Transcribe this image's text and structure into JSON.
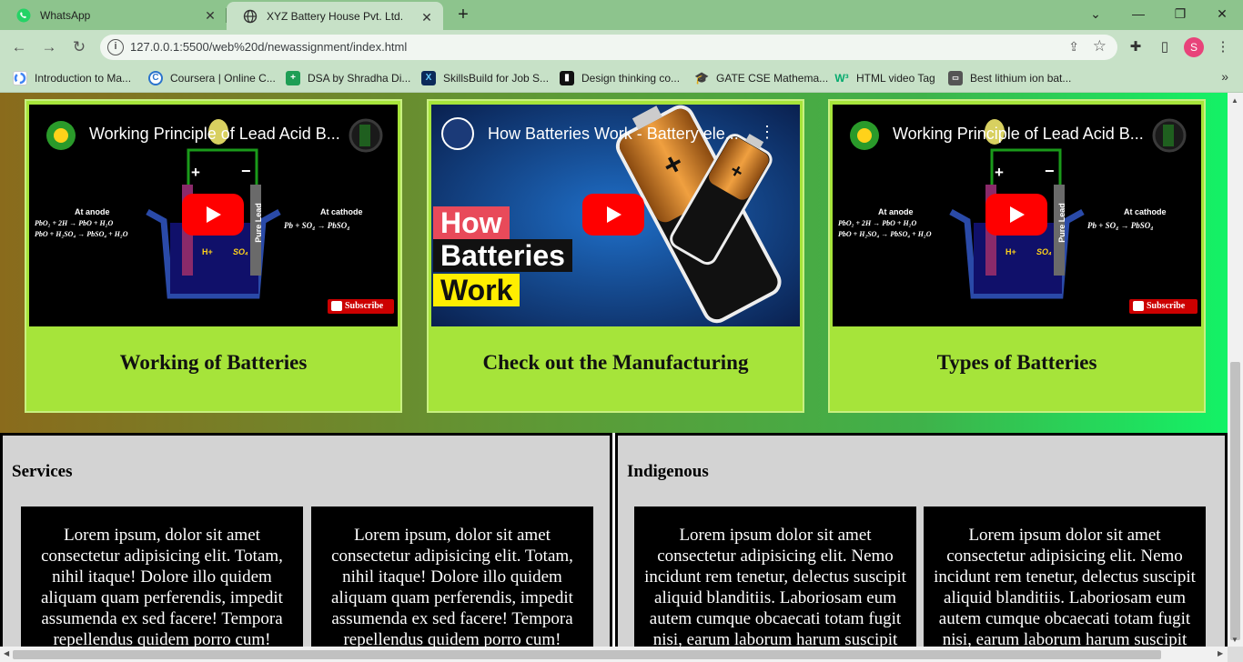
{
  "browser": {
    "tabs": [
      {
        "title": "WhatsApp",
        "icon": "whatsapp-icon"
      },
      {
        "title": "XYZ Battery House Pvt. Ltd.",
        "icon": "globe-icon"
      }
    ],
    "url": "127.0.0.1:5500/web%20d/newassignment/index.html",
    "profile_initial": "S",
    "bookmarks": [
      {
        "label": "Introduction to Ma...",
        "icon": "google-icon"
      },
      {
        "label": "Coursera | Online C...",
        "icon": "coursera-icon"
      },
      {
        "label": "DSA by Shradha Di...",
        "icon": "plus-doc-icon"
      },
      {
        "label": "SkillsBuild for Job S...",
        "icon": "skillsbuild-icon"
      },
      {
        "label": "Design thinking co...",
        "icon": "design-icon"
      },
      {
        "label": "GATE CSE Mathema...",
        "icon": "graduation-cap-icon"
      },
      {
        "label": "HTML video Tag",
        "icon": "w3-icon"
      },
      {
        "label": "Best lithium ion bat...",
        "icon": "battery-icon"
      }
    ]
  },
  "videos": [
    {
      "video_title": "Working Principle of Lead Acid B...",
      "caption": "Working of Batteries",
      "diagram": {
        "anode_heading": "At anode",
        "anode_line1": "PbO₂ + 2H → PbO + H₂O",
        "anode_line2": "PbO + H₂SO₄ → PbSO₄ + H₂O",
        "cathode_heading": "At cathode",
        "cathode_line": "Pb + SO₄ → PbSO₄",
        "plus_sign": "+",
        "minus_sign": "−",
        "right_plate": "Pure Lead",
        "ion_h": "H+",
        "ion_so4": "SO₄",
        "subscribe": "Subscribe"
      }
    },
    {
      "video_title": "How Batteries Work - Battery ele...",
      "caption": "Check out the Manufacturing",
      "overlay": {
        "line1": "How",
        "line2": "Batteries",
        "line3": "Work"
      }
    },
    {
      "video_title": "Working Principle of Lead Acid B...",
      "caption": "Types of Batteries",
      "diagram": {
        "anode_heading": "At anode",
        "anode_line1": "PbO₂ + 2H → PbO + H₂O",
        "anode_line2": "PbO + H₂SO₄ → PbSO₄ + H₂O",
        "cathode_heading": "At cathode",
        "cathode_line": "Pb + SO₄ → PbSO₄",
        "plus_sign": "+",
        "minus_sign": "−",
        "right_plate": "Pure Lead",
        "ion_h": "H+",
        "ion_so4": "SO₄",
        "subscribe": "Subscribe"
      }
    }
  ],
  "sections": [
    {
      "heading": "Services",
      "boxes": [
        "Lorem ipsum, dolor sit amet consectetur adipisicing elit. Totam, nihil itaque! Dolore illo quidem aliquam quam perferendis, impedit assumenda ex sed facere! Tempora repellendus quidem porro cum!",
        "Lorem ipsum, dolor sit amet consectetur adipisicing elit. Totam, nihil itaque! Dolore illo quidem aliquam quam perferendis, impedit assumenda ex sed facere! Tempora repellendus quidem porro cum!"
      ]
    },
    {
      "heading": "Indigenous",
      "boxes": [
        "Lorem ipsum dolor sit amet consectetur adipisicing elit. Nemo incidunt rem tenetur, delectus suscipit aliquid blanditiis. Laboriosam eum autem cumque obcaecati totam fugit nisi, earum laborum harum suscipit",
        "Lorem ipsum dolor sit amet consectetur adipisicing elit. Nemo incidunt rem tenetur, delectus suscipit aliquid blanditiis. Laboriosam eum autem cumque obcaecati totam fugit nisi, earum laborum harum suscipit"
      ]
    }
  ],
  "colors": {
    "tab_strip": "#8dc48d",
    "toolbar": "#c7e1c7",
    "card": "#a6e43a",
    "panel": "#d3d3d3",
    "youtube_red": "#ff0000"
  }
}
